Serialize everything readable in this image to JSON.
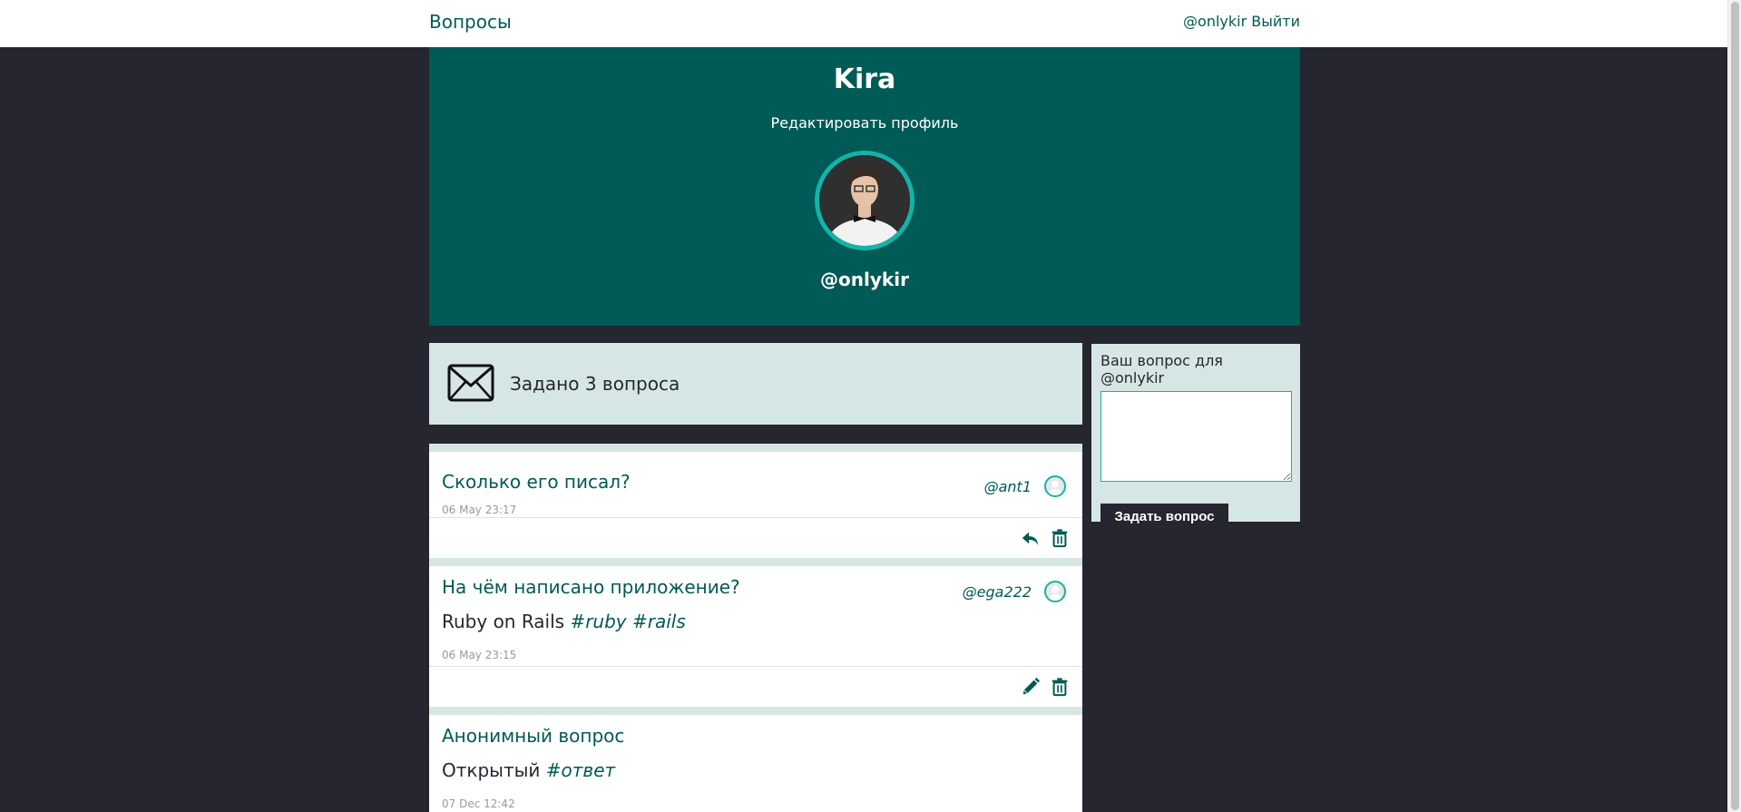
{
  "nav": {
    "brand": "Вопросы",
    "username": "@onlykir",
    "logout": "Выйти"
  },
  "profile": {
    "name": "Kira",
    "edit_link": "Редактировать профиль",
    "nickname": "@onlykir"
  },
  "counter": {
    "text": "Задано 3 вопроса"
  },
  "ask_form": {
    "label": "Ваш вопрос для @onlykir",
    "textarea_value": "",
    "button": "Задать вопрос"
  },
  "questions": [
    {
      "text": "Сколько его писал?",
      "author": "@ant1",
      "answer_text": "",
      "tags": [],
      "date": "06 May 23:17",
      "actions": [
        "reply-icon",
        "trash-icon"
      ]
    },
    {
      "text": "На чём написано приложение?",
      "author": "@ega222",
      "answer_text": "Ruby on Rails",
      "tags": [
        "#ruby",
        "#rails"
      ],
      "date": "06 May 23:15",
      "actions": [
        "pencil-icon",
        "trash-icon"
      ]
    },
    {
      "text": "Анонимный вопрос",
      "author": "",
      "answer_text": "Открытый",
      "tags": [
        "#ответ"
      ],
      "date": "07 Dec 12:42",
      "actions": []
    }
  ],
  "colors": {
    "primary": "#005a55",
    "accent": "#13b3a8",
    "background": "#262630",
    "light": "#d6e6e4"
  }
}
